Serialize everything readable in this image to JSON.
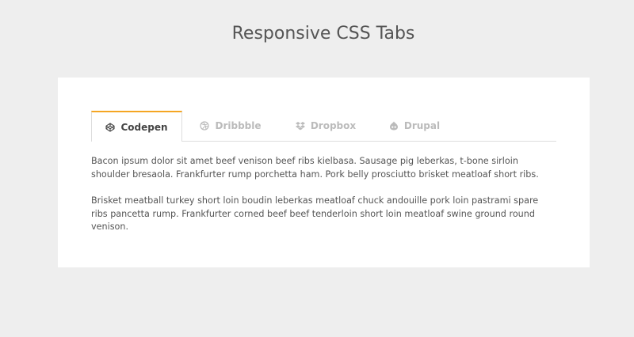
{
  "page": {
    "title": "Responsive CSS Tabs"
  },
  "tabs": [
    {
      "label": "Codepen",
      "icon": "codepen-icon",
      "active": true
    },
    {
      "label": "Dribbble",
      "icon": "dribbble-icon",
      "active": false
    },
    {
      "label": "Dropbox",
      "icon": "dropbox-icon",
      "active": false
    },
    {
      "label": "Drupal",
      "icon": "drupal-icon",
      "active": false
    }
  ],
  "content": {
    "paragraphs": [
      "Bacon ipsum dolor sit amet beef venison beef ribs kielbasa. Sausage pig leberkas, t-bone sirloin shoulder bresaola. Frankfurter rump porchetta ham. Pork belly prosciutto brisket meatloaf short ribs.",
      "Brisket meatball turkey short loin boudin leberkas meatloaf chuck andouille pork loin pastrami spare ribs pancetta rump. Frankfurter corned beef beef tenderloin short loin meatloaf swine ground round venison."
    ]
  },
  "colors": {
    "accent": "#f5a623",
    "background": "#eeeeee",
    "card": "#ffffff"
  }
}
